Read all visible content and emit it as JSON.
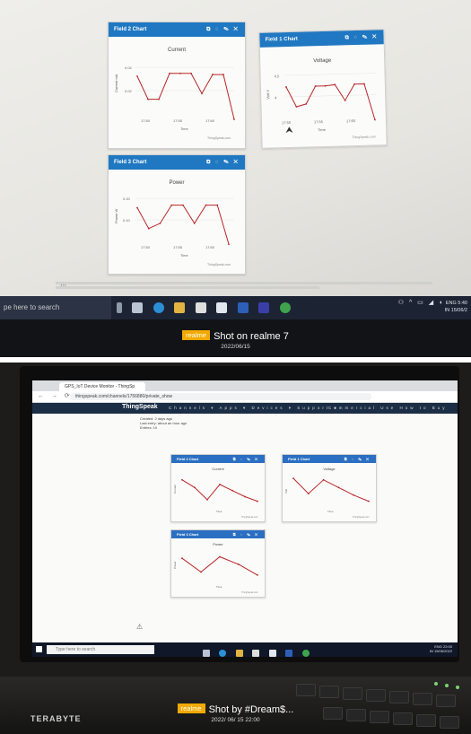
{
  "photo1": {
    "panels": [
      {
        "head": "Field 2 Chart",
        "chart_title": "Current",
        "ylabel": "Current mA",
        "xlabel": "Time",
        "yticks": [
          "0.04",
          "0.02"
        ],
        "xticks": [
          "17:50",
          "17:55",
          "17:60"
        ],
        "footer": "ThingSpeak.com",
        "points": [
          0.75,
          0.35,
          0.35,
          0.8,
          0.8,
          0.8,
          0.45,
          0.78,
          0.78,
          0.0
        ]
      },
      {
        "head": "Field 1 Chart",
        "chart_title": "Voltage",
        "ylabel": "Volt V",
        "xlabel": "Time",
        "yticks": [
          "4.5",
          "4"
        ],
        "xticks": [
          "17:50",
          "17:55",
          "17:60"
        ],
        "footer": "ThingSpeak.com",
        "points": [
          0.7,
          0.3,
          0.35,
          0.7,
          0.7,
          0.72,
          0.4,
          0.72,
          0.72,
          0.0
        ]
      },
      {
        "head": "Field 3 Chart",
        "chart_title": "Power",
        "ylabel": "Power W",
        "xlabel": "Time",
        "yticks": [
          "0.20",
          "0.10"
        ],
        "xticks": [
          "17:50",
          "17:55",
          "17:60"
        ],
        "footer": "ThingSpeak.com",
        "points": [
          0.75,
          0.35,
          0.45,
          0.8,
          0.8,
          0.45,
          0.8,
          0.8,
          0.05
        ]
      }
    ],
    "taskbar": {
      "search": "pe here to search",
      "lang": "ENG",
      "region": "IN",
      "time": "5:40",
      "date": "15/06/2"
    },
    "watermark": {
      "brand": "realme",
      "text": "Shot on realme 7",
      "date": "2022/06/15"
    }
  },
  "photo2": {
    "tab": "GPS_IoT Device Monitor - ThingSp",
    "url": "thingspeak.com/channels/1756880/private_show",
    "logo": "ThingSpeak",
    "menu": "Channels ▾   Apps ▾   Devices ▾   Support ▾",
    "menu_right": "Commercial Use   How to Buy",
    "meta": [
      "Created: 2 days ago",
      "Last entry: about an hour ago",
      "Entries: 10"
    ],
    "panels": [
      {
        "head": "Field 2 Chart",
        "chart_title": "Current",
        "ylabel": "Current",
        "xlabel": "Time",
        "footer": "ThingSpeak.com",
        "points": [
          0.8,
          0.55,
          0.15,
          0.65,
          0.45,
          0.25,
          0.1
        ]
      },
      {
        "head": "Field 1 Chart",
        "chart_title": "Voltage",
        "ylabel": "Volt",
        "xlabel": "Time",
        "footer": "ThingSpeak.com",
        "points": [
          0.85,
          0.35,
          0.8,
          0.55,
          0.3,
          0.1
        ]
      },
      {
        "head": "Field 3 Chart",
        "chart_title": "Power",
        "ylabel": "Power",
        "xlabel": "Time",
        "footer": "ThingSpeak.com",
        "points": [
          0.7,
          0.25,
          0.75,
          0.5,
          0.15
        ]
      }
    ],
    "taskbar": {
      "search": "Type here to search",
      "lang": "ENG",
      "region": "IN",
      "time": "22:00",
      "date": "15/06/2022"
    },
    "laptop_brand": "TERABYTE",
    "watermark": {
      "brand": "realme",
      "text": "Shot by #Dream$...",
      "date": "2022/ 06/ 15 22:00"
    }
  },
  "colors": {
    "header_blue": "#1f78c1",
    "line_red": "#b8262b",
    "taskbar": "#1c2333",
    "realme_yellow": "#f2a900"
  }
}
